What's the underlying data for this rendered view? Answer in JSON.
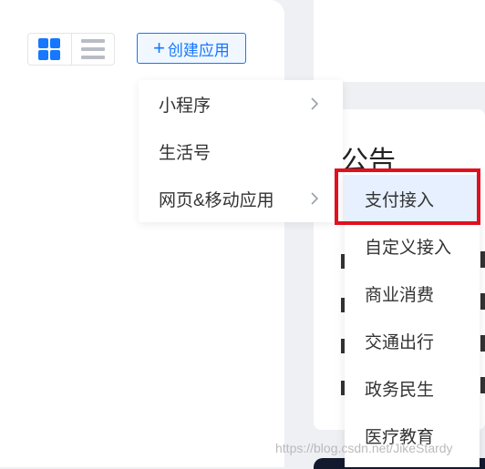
{
  "toolbar": {
    "create_label": "创建应用",
    "plus_glyph": "+"
  },
  "menu": {
    "items": [
      {
        "label": "小程序"
      },
      {
        "label": "生活号"
      },
      {
        "label": "网页&移动应用"
      }
    ]
  },
  "submenu": {
    "items": [
      {
        "label": "支付接入",
        "active": true
      },
      {
        "label": "自定义接入"
      },
      {
        "label": "商业消费"
      },
      {
        "label": "交通出行"
      },
      {
        "label": "政务民生"
      },
      {
        "label": "医疗教育"
      }
    ]
  },
  "notice": {
    "title": "公告"
  },
  "watermark": "https://blog.csdn.net/JikeStardy",
  "colors": {
    "accent": "#1677ff",
    "highlight": "#e0101f"
  }
}
